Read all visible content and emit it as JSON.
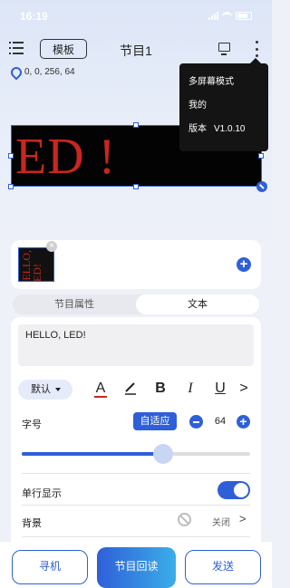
{
  "status_bar": {
    "time": "16:19"
  },
  "header": {
    "template_label": "模板",
    "title": "节目1"
  },
  "coordinates": "0,  0,  256,  64",
  "menu": {
    "items": [
      "多屏幕模式",
      "我的"
    ],
    "version_label": "版本",
    "version_value": "V1.0.10"
  },
  "led_preview": {
    "text": "ED !"
  },
  "program_list": {
    "thumbnail_text": "HELLO, LED!"
  },
  "tabs": {
    "program_props": "节目属性",
    "text": "文本",
    "active": "文本"
  },
  "text_editor": {
    "content": "HELLO, LED!"
  },
  "font_toolbar": {
    "font_select": "默认",
    "bold": "B",
    "italic": "I",
    "underline": "U",
    "more": ">"
  },
  "font_size": {
    "label": "字号",
    "auto_label": "自适应",
    "value": "64",
    "slider_fraction": 0.62
  },
  "single_line": {
    "label": "单行显示",
    "enabled": true
  },
  "background": {
    "label": "背景",
    "value": "关闭"
  },
  "bottom_actions": {
    "find": "寻机",
    "read_back": "节目回读",
    "send": "发送"
  },
  "colors": {
    "accent": "#2f5fd8",
    "led_red": "#c8261f",
    "menu_bg": "#141414"
  }
}
